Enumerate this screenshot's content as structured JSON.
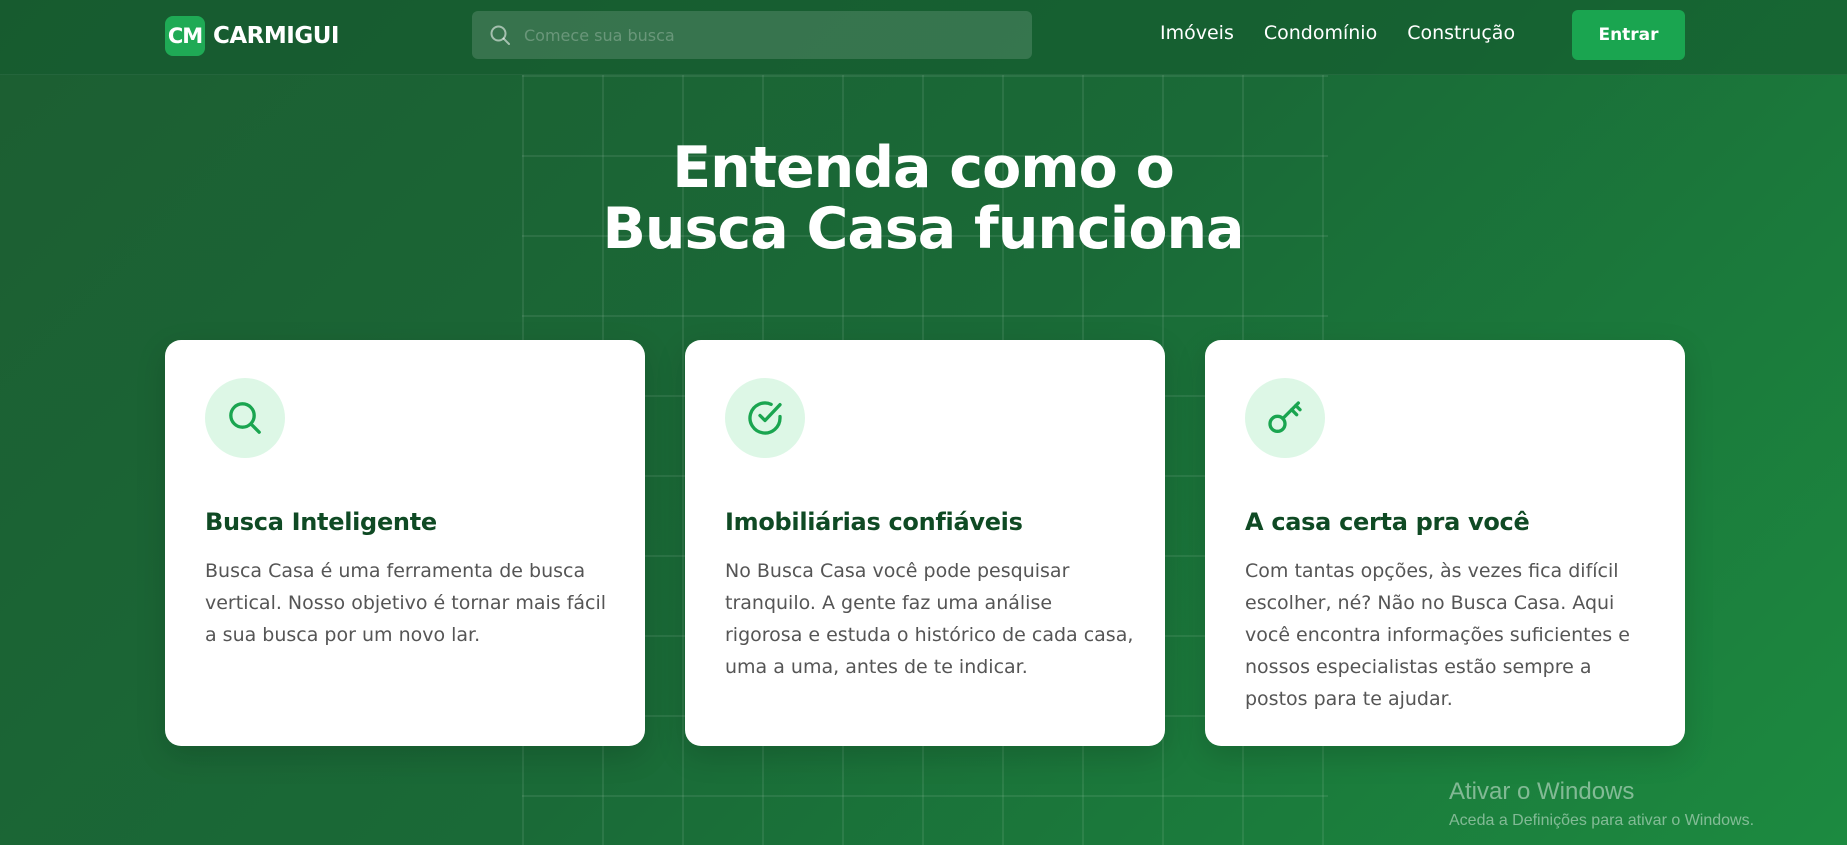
{
  "header": {
    "logo_badge": "CM",
    "brand": "CARMIGUI",
    "search_placeholder": "Comece sua busca",
    "nav": [
      "Imóveis",
      "Condomínio",
      "Construção"
    ],
    "enter_label": "Entrar"
  },
  "hero": {
    "title_line1": "Entenda como o",
    "title_line2": "Busca Casa funciona"
  },
  "cards": [
    {
      "icon": "search-icon",
      "title": "Busca Inteligente",
      "text": "Busca Casa é uma ferramenta de busca vertical. Nosso objetivo é tornar mais fácil a sua busca por um novo lar."
    },
    {
      "icon": "check-circle-icon",
      "title": "Imobiliárias confiáveis",
      "text": "No Busca Casa você pode pesquisar tranquilo. A gente faz uma análise rigorosa e estuda o histórico de cada casa, uma a uma, antes de te indicar."
    },
    {
      "icon": "key-icon",
      "title": "A casa certa pra você",
      "text": "Com tantas opções, às vezes fica difícil escolher, né? Não no Busca Casa. Aqui você encontra informações suficientes e nossos especialistas estão sempre a postos para te ajudar."
    }
  ],
  "watermark": {
    "line1": "Ativar o Windows",
    "line2": "Aceda a Definições para ativar o Windows."
  },
  "colors": {
    "accent": "#1aa550",
    "card_title": "#0f4a24",
    "icon_bg": "#ddf7e6"
  }
}
